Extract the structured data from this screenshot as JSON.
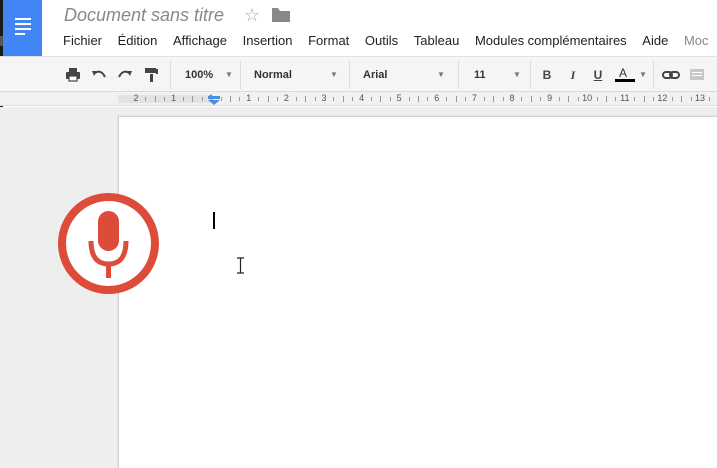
{
  "document": {
    "title": "Document sans titre"
  },
  "menu": {
    "items": [
      "Fichier",
      "Édition",
      "Affichage",
      "Insertion",
      "Format",
      "Outils",
      "Tableau",
      "Modules complémentaires",
      "Aide",
      "Moc"
    ]
  },
  "toolbar": {
    "zoom": "100%",
    "style": "Normal",
    "font": "Arial",
    "size": "11",
    "bold": "B",
    "italic": "I",
    "underline": "U",
    "text_color": "A"
  },
  "ruler": {
    "labels": [
      "2",
      "1",
      "1",
      "1",
      "2",
      "3",
      "4",
      "5",
      "6",
      "7",
      "8",
      "9",
      "10",
      "11",
      "12",
      "13"
    ]
  },
  "colors": {
    "brand": "#4285f4",
    "mic": "#dd4b39",
    "ruler_marker": "#4a90e2"
  },
  "icons": {
    "logo": "docs-lines-icon",
    "star": "star-icon",
    "folder": "folder-icon",
    "print": "print-icon",
    "undo": "undo-icon",
    "redo": "redo-icon",
    "paint_format": "paint-format-icon",
    "link": "link-icon",
    "comment": "comment-icon",
    "mic": "microphone-icon",
    "cursor": "ibeam-cursor-icon"
  }
}
